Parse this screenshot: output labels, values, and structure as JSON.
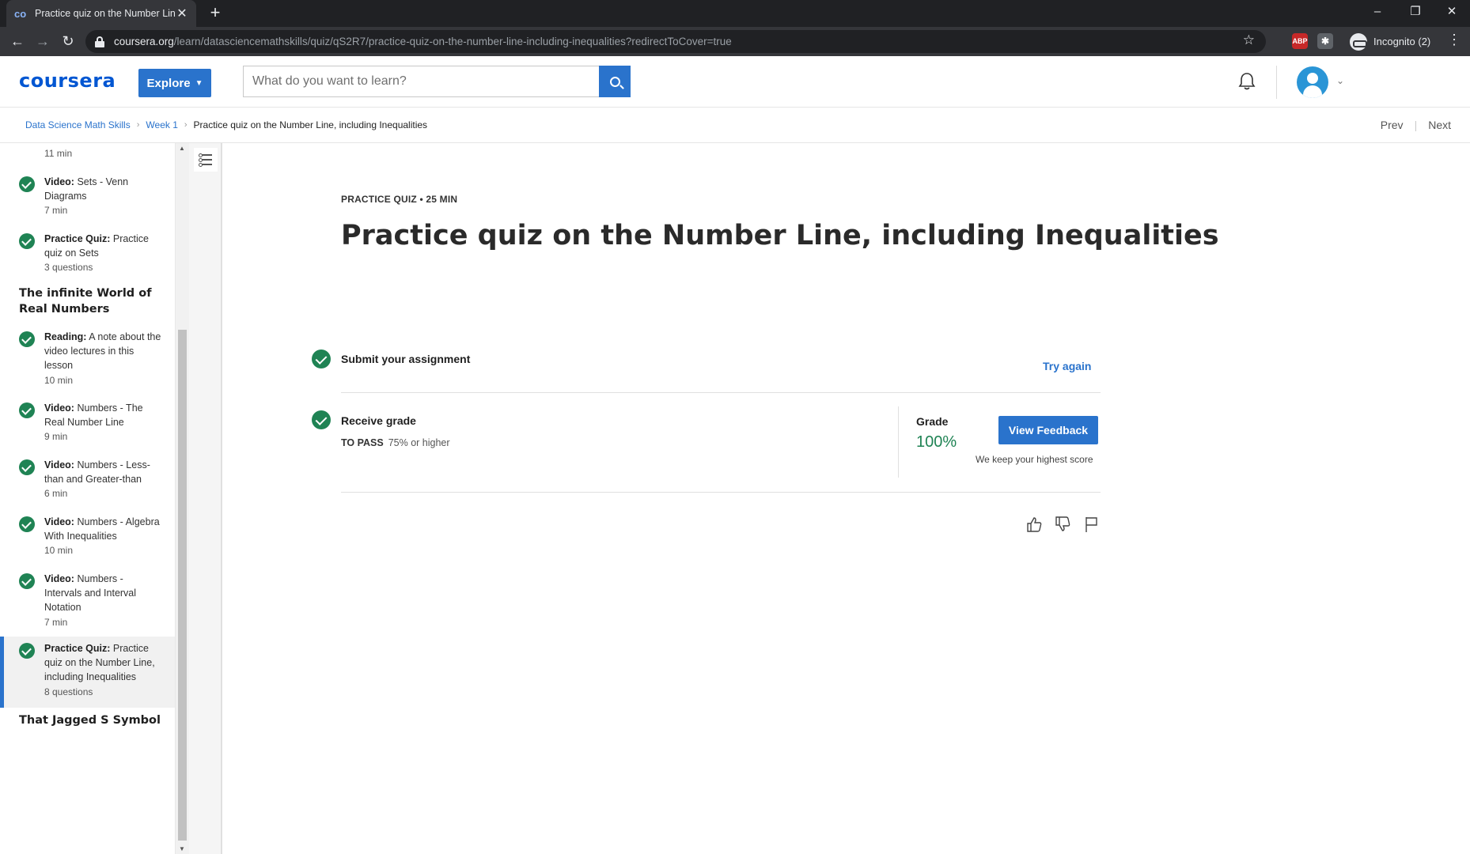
{
  "browser": {
    "tab_title": "Practice quiz on the Number Line",
    "tab_favicon": "co",
    "url_host": "coursera.org",
    "url_path": "/learn/datasciencemathskills/quiz/qS2R7/practice-quiz-on-the-number-line-including-inequalities?redirectToCover=true",
    "incognito_label": "Incognito (2)",
    "ext_badge": "ABP",
    "window_controls": [
      "–",
      "❐",
      "✕"
    ]
  },
  "header": {
    "logo": "coursera",
    "explore_label": "Explore",
    "search_placeholder": "What do you want to learn?"
  },
  "breadcrumb": {
    "items": [
      "Data Science Math Skills",
      "Week 1",
      "Practice quiz on the Number Line, including Inequalities"
    ],
    "prev": "Prev",
    "next": "Next"
  },
  "sidebar": {
    "top_partial_meta": "11 min",
    "items": [
      {
        "type": "Video:",
        "title": "Sets - Venn Diagrams",
        "meta": "7 min"
      },
      {
        "type": "Practice Quiz:",
        "title": "Practice quiz on Sets",
        "meta": "3 questions"
      },
      {
        "type": "Reading:",
        "title": "A note about the video lectures in this lesson",
        "meta": "10 min"
      },
      {
        "type": "Video:",
        "title": "Numbers - The Real Number Line",
        "meta": "9 min"
      },
      {
        "type": "Video:",
        "title": "Numbers - Less-than and Greater-than",
        "meta": "6 min"
      },
      {
        "type": "Video:",
        "title": "Numbers - Algebra With Inequalities",
        "meta": "10 min"
      },
      {
        "type": "Video:",
        "title": "Numbers - Intervals and Interval Notation",
        "meta": "7 min"
      },
      {
        "type": "Practice Quiz:",
        "title": "Practice quiz on the Number Line, including Inequalities",
        "meta": "8 questions"
      }
    ],
    "sections": [
      "The infinite World of Real Numbers",
      "That Jagged S Symbol"
    ]
  },
  "main": {
    "eyebrow": "PRACTICE QUIZ • 25 MIN",
    "title": "Practice quiz on the Number Line, including Inequalities",
    "submit_label": "Submit your assignment",
    "try_again": "Try again",
    "receive_label": "Receive grade",
    "to_pass_label": "TO PASS",
    "to_pass_value": "75% or higher",
    "grade_label": "Grade",
    "grade_value": "100%",
    "view_feedback": "View Feedback",
    "keep_note": "We keep your highest score"
  },
  "colors": {
    "brand_blue": "#2a73cc",
    "success_green": "#1f8354"
  }
}
